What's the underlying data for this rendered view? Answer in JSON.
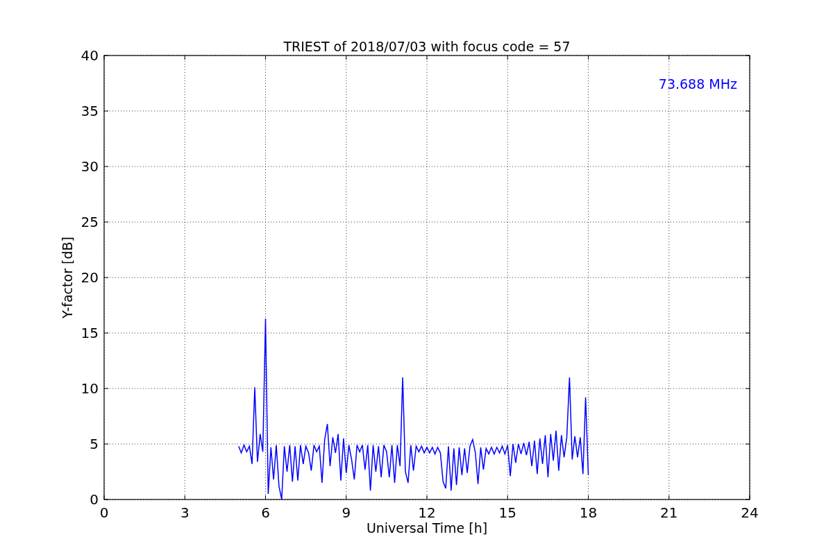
{
  "chart_data": {
    "type": "line",
    "title": "TRIEST of 2018/07/03 with focus code = 57",
    "xlabel": "Universal Time [h]",
    "ylabel": "Y-factor [dB]",
    "xlim": [
      0,
      24
    ],
    "ylim": [
      0,
      40
    ],
    "xticks": [
      0,
      3,
      6,
      9,
      12,
      15,
      18,
      21,
      24
    ],
    "yticks": [
      0,
      5,
      10,
      15,
      20,
      25,
      30,
      35,
      40
    ],
    "x": [
      5.0,
      5.1,
      5.2,
      5.3,
      5.4,
      5.5,
      5.6,
      5.7,
      5.8,
      5.9,
      6.0,
      6.1,
      6.2,
      6.3,
      6.4,
      6.5,
      6.6,
      6.7,
      6.8,
      6.9,
      7.0,
      7.1,
      7.2,
      7.3,
      7.4,
      7.5,
      7.6,
      7.7,
      7.8,
      7.9,
      8.0,
      8.1,
      8.2,
      8.3,
      8.4,
      8.5,
      8.6,
      8.7,
      8.8,
      8.9,
      9.0,
      9.1,
      9.2,
      9.3,
      9.4,
      9.5,
      9.6,
      9.7,
      9.8,
      9.9,
      10.0,
      10.1,
      10.2,
      10.3,
      10.4,
      10.5,
      10.6,
      10.7,
      10.8,
      10.9,
      11.0,
      11.1,
      11.2,
      11.3,
      11.4,
      11.5,
      11.6,
      11.7,
      11.8,
      11.9,
      12.0,
      12.1,
      12.2,
      12.3,
      12.4,
      12.5,
      12.6,
      12.7,
      12.8,
      12.9,
      13.0,
      13.1,
      13.2,
      13.3,
      13.4,
      13.5,
      13.6,
      13.7,
      13.8,
      13.9,
      14.0,
      14.1,
      14.2,
      14.3,
      14.4,
      14.5,
      14.6,
      14.7,
      14.8,
      14.9,
      15.0,
      15.1,
      15.2,
      15.3,
      15.4,
      15.5,
      15.6,
      15.7,
      15.8,
      15.9,
      16.0,
      16.1,
      16.2,
      16.3,
      16.4,
      16.5,
      16.6,
      16.7,
      16.8,
      16.9,
      17.0,
      17.1,
      17.2,
      17.3,
      17.4,
      17.5,
      17.6,
      17.7,
      17.8,
      17.9,
      18.0
    ],
    "series": [
      {
        "color": "#0000ff",
        "values": [
          4.8,
          4.2,
          4.9,
          4.3,
          4.8,
          3.2,
          10.1,
          3.4,
          5.9,
          4.3,
          16.3,
          0.5,
          4.7,
          1.8,
          4.9,
          1.2,
          0,
          4.8,
          2.5,
          4.9,
          1.6,
          4.8,
          1.7,
          4.9,
          3.2,
          4.8,
          4.2,
          2.6,
          4.9,
          4.3,
          4.8,
          1.5,
          5.4,
          6.8,
          3.0,
          5.6,
          4.2,
          5.9,
          1.7,
          5.5,
          2.4,
          4.9,
          3.6,
          1.8,
          4.9,
          4.3,
          4.9,
          2.7,
          4.9,
          0.8,
          4.9,
          2.5,
          4.8,
          2.0,
          4.9,
          4.3,
          2.0,
          4.9,
          1.5,
          4.9,
          3.0,
          11.0,
          2.5,
          1.5,
          4.9,
          2.6,
          4.8,
          4.3,
          4.8,
          4.2,
          4.7,
          4.2,
          4.7,
          4.1,
          4.7,
          4.2,
          1.6,
          1.0,
          4.8,
          0.8,
          4.6,
          1.3,
          4.7,
          2.2,
          4.6,
          2.4,
          4.8,
          5.4,
          4.2,
          1.4,
          4.7,
          2.7,
          4.6,
          4.1,
          4.7,
          4.1,
          4.7,
          4.2,
          4.8,
          4.1,
          4.9,
          2.1,
          5.0,
          3.3,
          5.0,
          4.1,
          5.1,
          4.0,
          5.2,
          3.0,
          5.3,
          2.3,
          5.5,
          3.2,
          5.8,
          2.0,
          5.9,
          3.5,
          6.2,
          2.6,
          5.8,
          3.8,
          5.6,
          11.0,
          3.6,
          5.7,
          3.8,
          5.6,
          2.3,
          9.2,
          2.2
        ]
      }
    ],
    "grid": true,
    "annotations": [
      {
        "text": "73.688 MHz"
      }
    ]
  }
}
